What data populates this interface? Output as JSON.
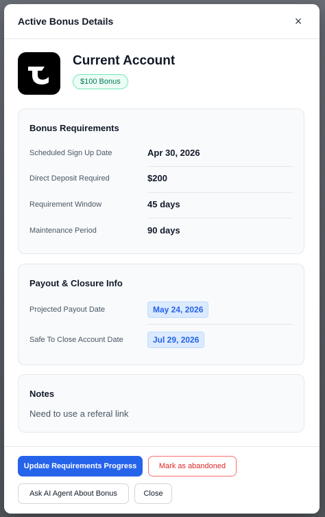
{
  "modal": {
    "title": "Active Bonus Details",
    "close_symbol": "×"
  },
  "account": {
    "name": "Current Account",
    "bonus_badge": "$100 Bonus",
    "logo_icon": "current-logo-icon"
  },
  "requirements": {
    "title": "Bonus Requirements",
    "rows": [
      {
        "label": "Scheduled Sign Up Date",
        "value": "Apr 30, 2026"
      },
      {
        "label": "Direct Deposit Required",
        "value": "$200"
      },
      {
        "label": "Requirement Window",
        "value": "45 days"
      },
      {
        "label": "Maintenance Period",
        "value": "90 days"
      }
    ]
  },
  "payout": {
    "title": "Payout & Closure Info",
    "rows": [
      {
        "label": "Projected Payout Date",
        "value": "May 24, 2026"
      },
      {
        "label": "Safe To Close Account Date",
        "value": "Jul 29, 2026"
      }
    ]
  },
  "notes": {
    "title": "Notes",
    "text": "Need to use a referal link"
  },
  "actions": {
    "update_label": "Update Requirements Progress",
    "abandon_label": "Mark as abandoned",
    "ask_ai_label": "Ask AI Agent About Bonus",
    "close_label": "Close"
  },
  "colors": {
    "primary": "#2563eb",
    "danger": "#dc2626",
    "success": "#047857",
    "date_pill_bg": "#dbeafe"
  }
}
